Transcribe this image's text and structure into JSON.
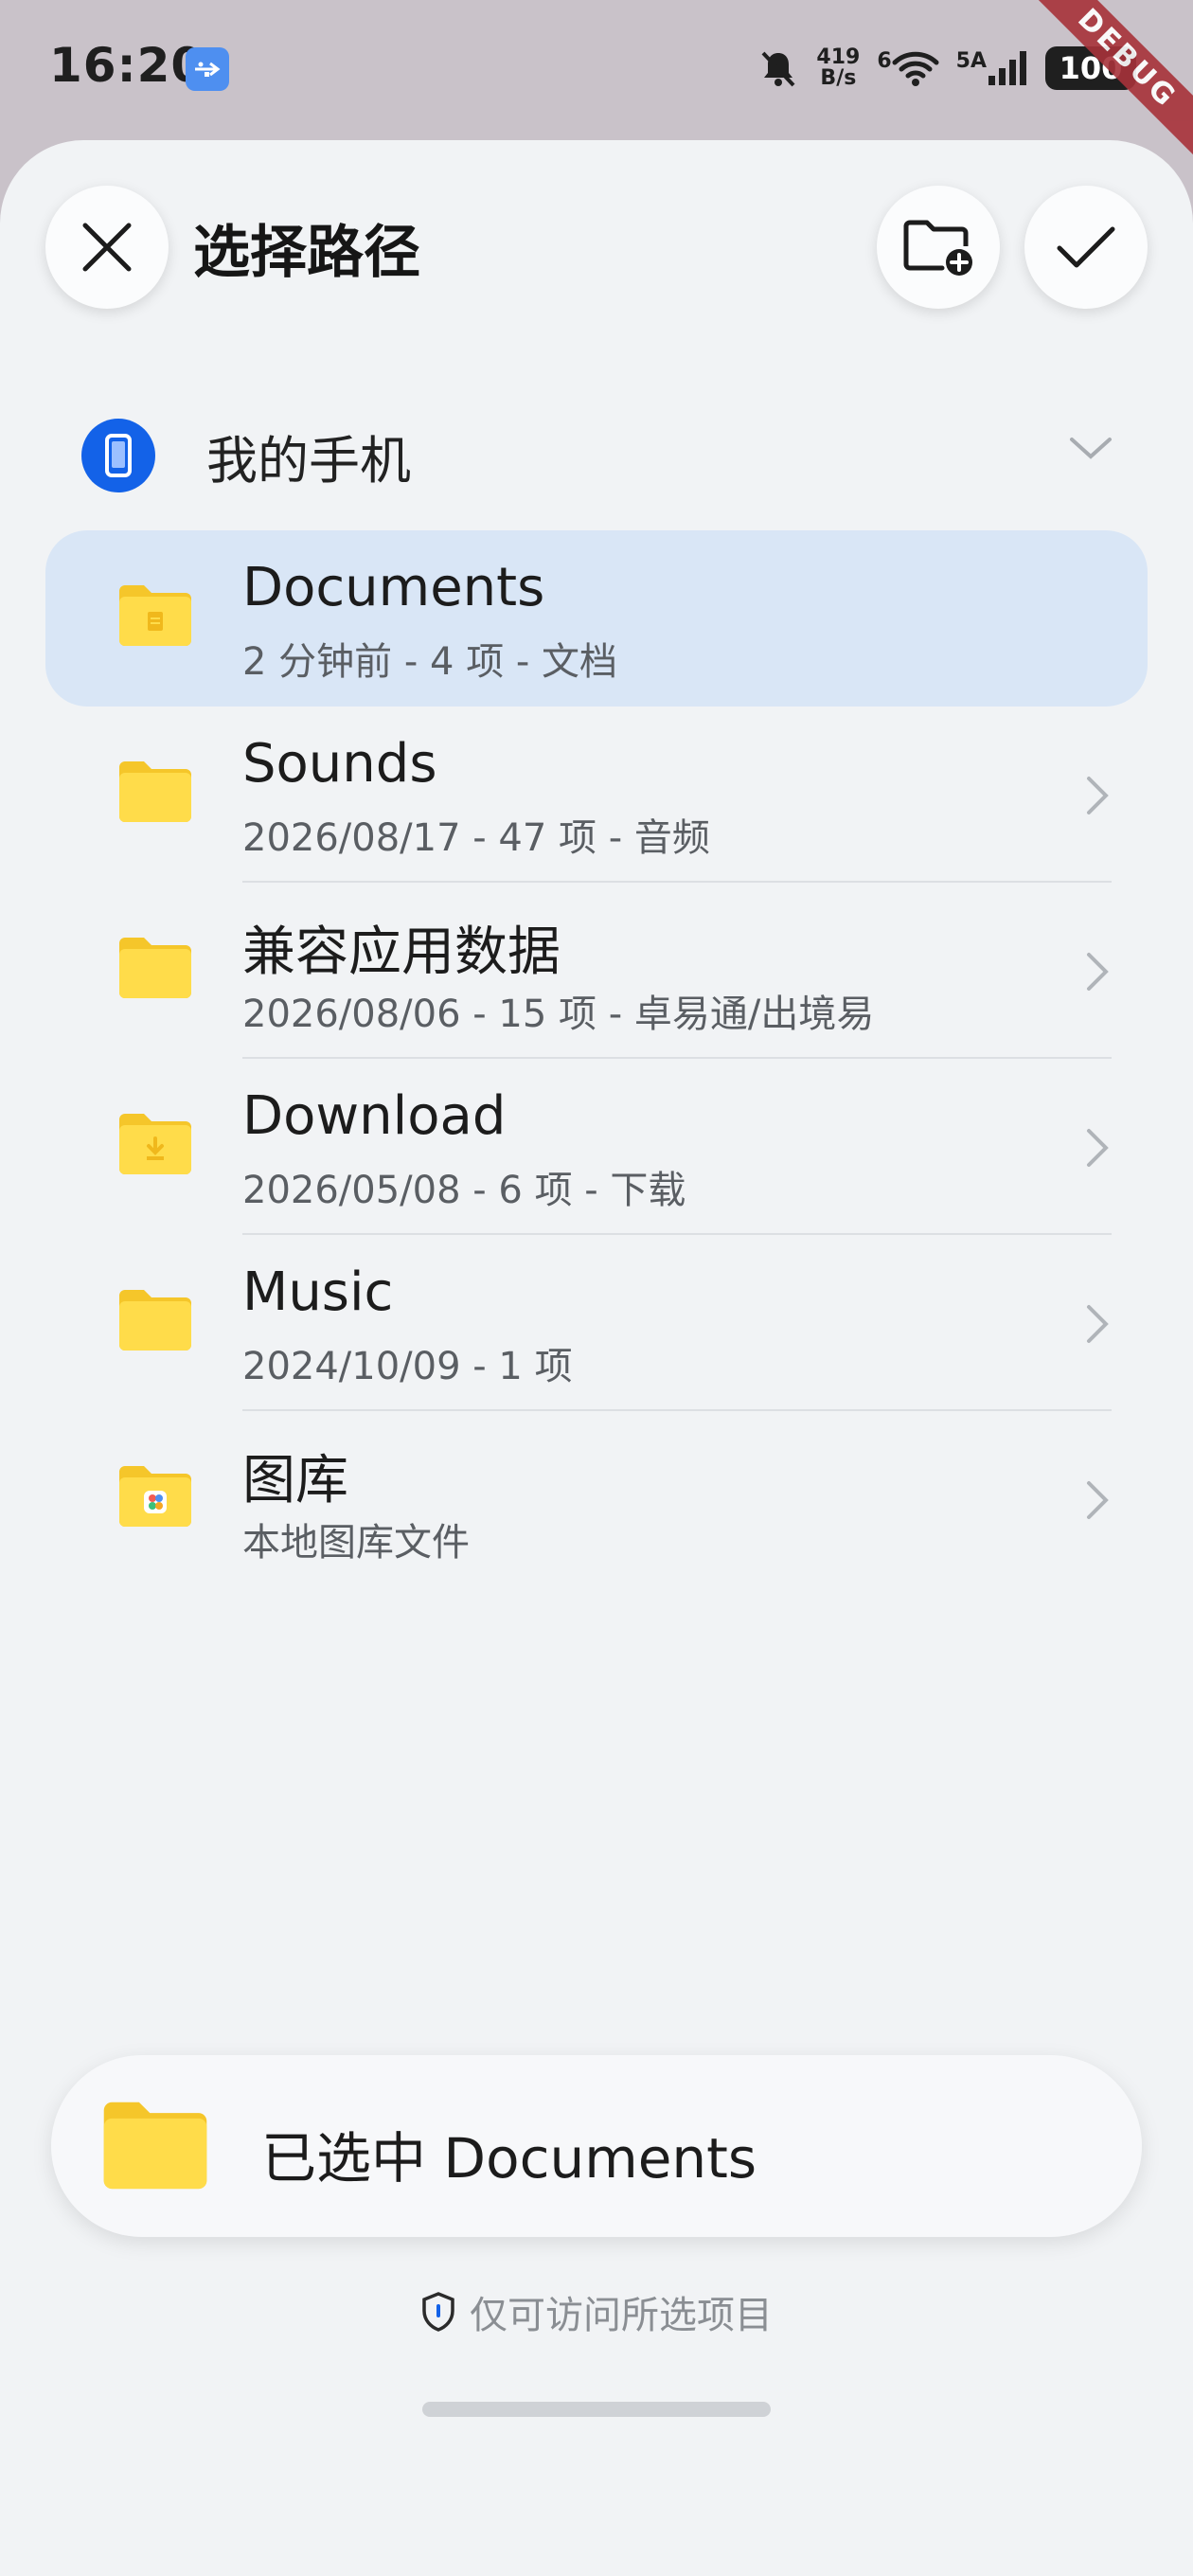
{
  "status_bar": {
    "time": "16:20",
    "net_speed_value": "419",
    "net_speed_unit": "B/s",
    "wifi_label": "6",
    "cell_label": "5A",
    "battery": "100",
    "debug_label": "DEBUG"
  },
  "header": {
    "title": "选择路径"
  },
  "device": {
    "label": "我的手机"
  },
  "folders": [
    {
      "name": "Documents",
      "meta": "2 分钟前 - 4 项 - 文档",
      "icon": "folder-documents-icon",
      "selected": true
    },
    {
      "name": "Sounds",
      "meta": "2026/08/17 - 47 项 - 音频",
      "icon": "folder-icon",
      "selected": false
    },
    {
      "name": "兼容应用数据",
      "meta": "2026/08/06 - 15 项 - 卓易通/出境易",
      "icon": "folder-icon",
      "selected": false
    },
    {
      "name": "Download",
      "meta": "2026/05/08 - 6 项 - 下载",
      "icon": "folder-download-icon",
      "selected": false
    },
    {
      "name": "Music",
      "meta": "2024/10/09 - 1 项",
      "icon": "folder-icon",
      "selected": false
    },
    {
      "name": "图库",
      "meta": "本地图库文件",
      "icon": "folder-gallery-icon",
      "selected": false
    }
  ],
  "selection": {
    "text": "已选中 Documents"
  },
  "footer": {
    "access_note": "仅可访问所选项目"
  },
  "colors": {
    "accent": "#1362e8",
    "selected_row": "#d9e6f6",
    "folder_yellow": "#ffd83a",
    "sheet_bg": "#f1f3f5"
  }
}
